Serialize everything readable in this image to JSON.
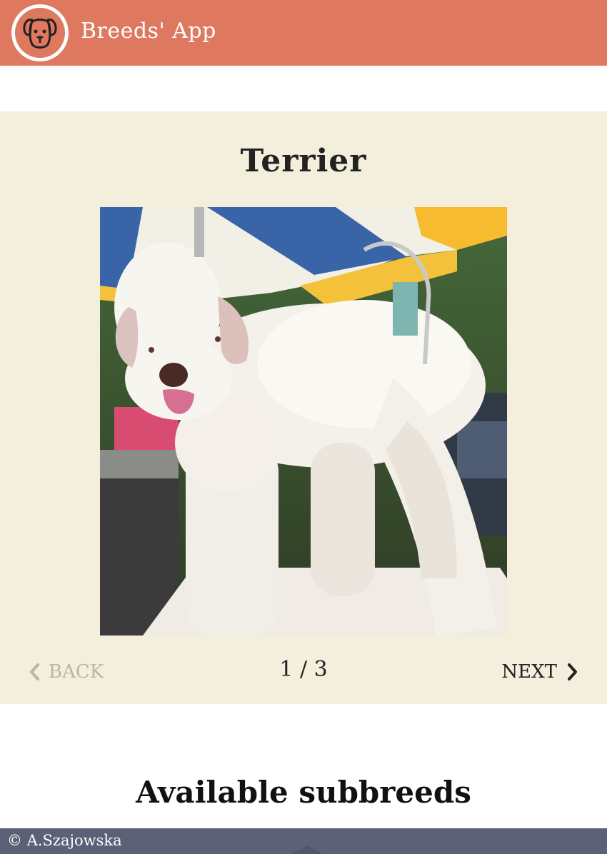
{
  "header": {
    "app_title": "Breeds' App",
    "logo_icon": "dog-face-icon",
    "background_color": "#de785e"
  },
  "gallery": {
    "breed_name": "Terrier",
    "photo_icon": "dog-photo",
    "current_index": 1,
    "total": 3,
    "back_label": "BACK",
    "next_label": "NEXT",
    "counter_current": "1",
    "counter_separator": "/",
    "counter_total": "3",
    "background_color": "#f3efdc"
  },
  "subbreeds": {
    "title": "Available subbreeds"
  },
  "footer": {
    "text": "© A.Szajowska",
    "background_color": "#5d6178"
  }
}
